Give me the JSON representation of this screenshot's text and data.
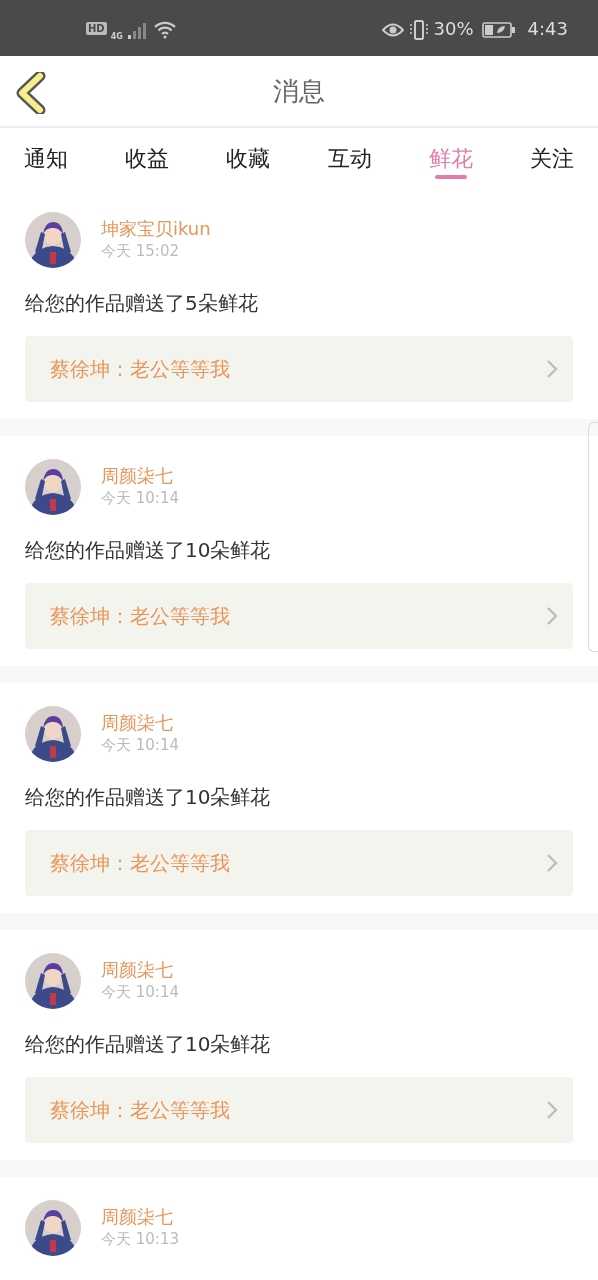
{
  "status_bar": {
    "hd": "HD",
    "network": "4G",
    "battery": "30%",
    "time": "4:43"
  },
  "header": {
    "title": "消息"
  },
  "tabs": [
    {
      "label": "通知",
      "selected": false
    },
    {
      "label": "收益",
      "selected": false
    },
    {
      "label": "收藏",
      "selected": false
    },
    {
      "label": "互动",
      "selected": false
    },
    {
      "label": "鲜花",
      "selected": true
    },
    {
      "label": "关注",
      "selected": false
    }
  ],
  "messages": [
    {
      "user": "坤家宝贝ikun",
      "time": "今天 15:02",
      "text": "给您的作品赠送了5朵鲜花",
      "quote": "蔡徐坤：老公等等我"
    },
    {
      "user": "周颜柒七",
      "time": "今天 10:14",
      "text": "给您的作品赠送了10朵鲜花",
      "quote": "蔡徐坤：老公等等我"
    },
    {
      "user": "周颜柒七",
      "time": "今天 10:14",
      "text": "给您的作品赠送了10朵鲜花",
      "quote": "蔡徐坤：老公等等我"
    },
    {
      "user": "周颜柒七",
      "time": "今天 10:14",
      "text": "给您的作品赠送了10朵鲜花",
      "quote": "蔡徐坤：老公等等我"
    },
    {
      "user": "周颜柒七",
      "time": "今天 10:13"
    }
  ]
}
